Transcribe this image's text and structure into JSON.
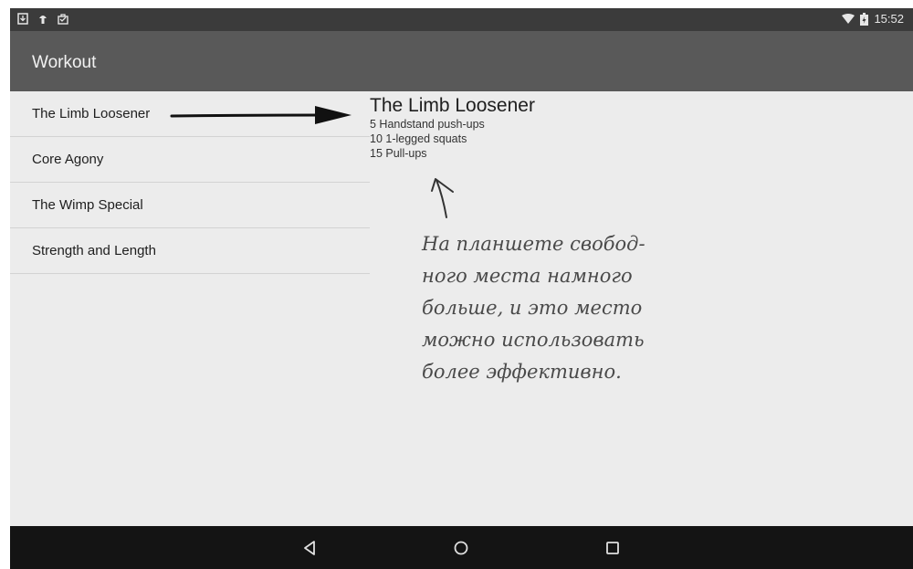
{
  "status_bar": {
    "time": "15:52",
    "left_icons": [
      "download-icon",
      "android-icon",
      "briefcase-icon"
    ],
    "right_icons": [
      "wifi-icon",
      "battery-icon"
    ]
  },
  "app_bar": {
    "title": "Workout"
  },
  "workout_list": [
    {
      "label": "The Limb Loosener"
    },
    {
      "label": "Core Agony"
    },
    {
      "label": "The Wimp Special"
    },
    {
      "label": "Strength and Length"
    }
  ],
  "detail": {
    "title": "The Limb Loosener",
    "lines": [
      "5 Handstand push-ups",
      "10 1-legged squats",
      "15 Pull-ups"
    ]
  },
  "annotation": {
    "text": "На планшете свобод-\nного места намного\nбольше, и это место\nможно использовать\nболее эффективно."
  },
  "nav_bar": {
    "buttons": [
      "back-icon",
      "home-icon",
      "recents-icon"
    ]
  },
  "colors": {
    "status_bar": "#3b3b3b",
    "app_bar": "#595959",
    "content_bg": "#ececec",
    "nav_bar": "#141414"
  }
}
